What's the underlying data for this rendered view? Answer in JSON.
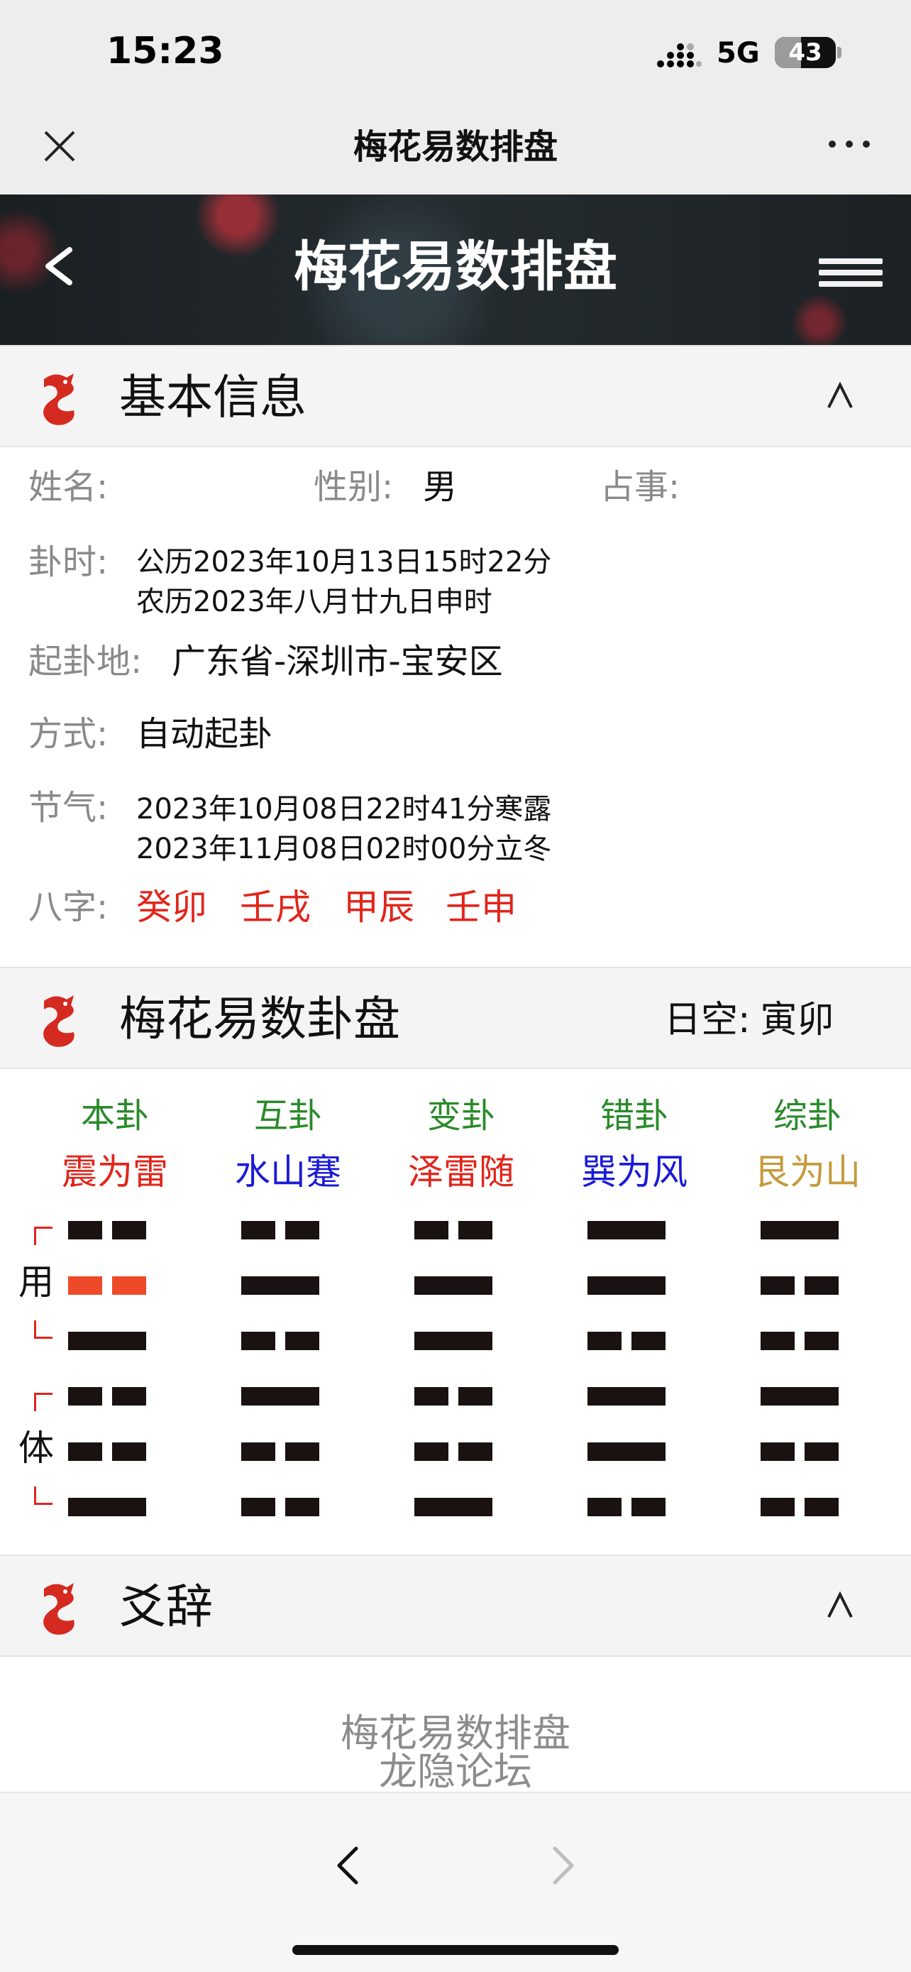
{
  "status_bar": {
    "time": "15:23",
    "network": "5G",
    "battery": "43",
    "battery_level": 0.43
  },
  "wechat_nav": {
    "title": "梅花易数排盘",
    "close_icon": "close-icon",
    "more_icon": "more-dots-icon"
  },
  "banner": {
    "title": "梅花易数排盘",
    "back_icon": "chevron-left-icon",
    "menu_icon": "hamburger-menu-icon"
  },
  "basic_info": {
    "title": "基本信息",
    "logo_icon": "dragon-logo-icon",
    "collapse_icon": "caret-up-icon",
    "name_label": "姓名:",
    "name_value": "",
    "gender_label": "性别:",
    "gender_value": "男",
    "matter_label": "占事:",
    "matter_value": "",
    "time_label": "卦时:",
    "time_solar": "公历2023年10月13日15时22分",
    "time_lunar": "农历2023年八月廿九日申时",
    "place_label": "起卦地:",
    "place_value": "广东省-深圳市-宝安区",
    "method_label": "方式:",
    "method_value": "自动起卦",
    "term_label": "节气:",
    "term_1": "2023年10月08日22时41分寒露",
    "term_2": "2023年11月08日02时00分立冬",
    "bazi_label": "八字:",
    "bazi": [
      "癸卯",
      "壬戌",
      "甲辰",
      "壬申"
    ],
    "bazi_color": "#e1251b"
  },
  "gua_pan": {
    "title": "梅花易数卦盘",
    "logo_icon": "dragon-logo-icon",
    "kong_label": "日空:",
    "kong_value": "寅卯",
    "side_top": "用",
    "side_bottom": "体",
    "columns": [
      {
        "type": "本卦",
        "name": "震为雷",
        "name_color": "#e1251b",
        "lines": [
          0,
          0,
          1,
          0,
          0,
          1
        ],
        "moving": 1
      },
      {
        "type": "互卦",
        "name": "水山蹇",
        "name_color": "#1a1ad6",
        "lines": [
          0,
          1,
          0,
          1,
          0,
          0
        ]
      },
      {
        "type": "变卦",
        "name": "泽雷随",
        "name_color": "#e1251b",
        "lines": [
          0,
          1,
          1,
          0,
          0,
          1
        ]
      },
      {
        "type": "错卦",
        "name": "巽为风",
        "name_color": "#1a1ad6",
        "lines": [
          1,
          1,
          0,
          1,
          1,
          0
        ]
      },
      {
        "type": "综卦",
        "name": "艮为山",
        "name_color": "#c49a3a",
        "lines": [
          1,
          0,
          0,
          1,
          0,
          0
        ]
      }
    ],
    "type_color": "#2a8a2a",
    "moving_color": "#ee4a2a"
  },
  "yaoci": {
    "title": "爻辞",
    "logo_icon": "dragon-logo-icon",
    "collapse_icon": "caret-up-icon"
  },
  "footer": {
    "line1": "梅花易数排盘",
    "line2": "龙隐论坛"
  },
  "browser_nav": {
    "back_icon": "chevron-left-icon",
    "forward_icon": "chevron-right-icon"
  }
}
